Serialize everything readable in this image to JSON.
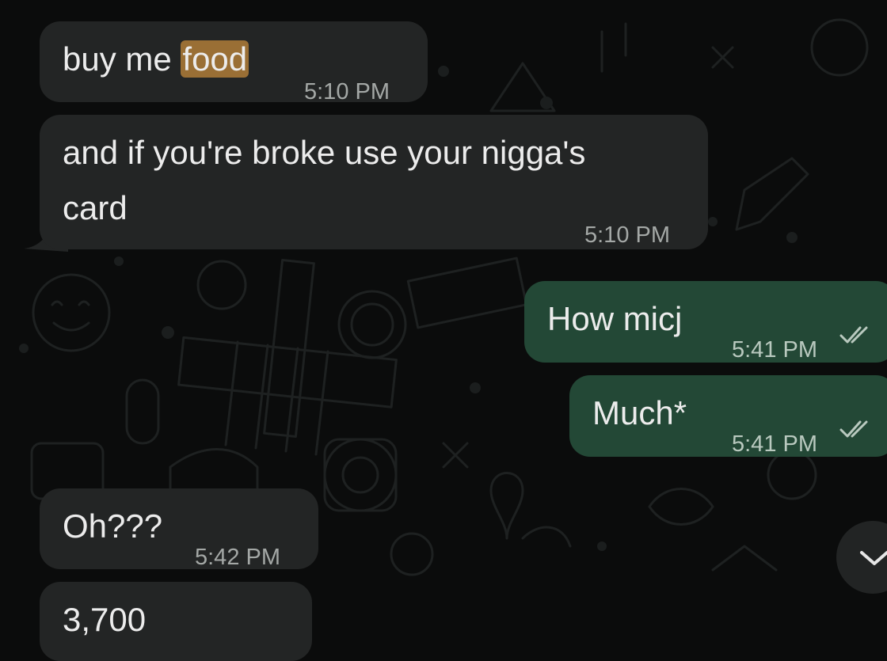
{
  "messages": [
    {
      "prefix": "buy me ",
      "highlight": "food",
      "time": "5:10 PM"
    },
    {
      "line1": "and if you're broke use your nigga's",
      "line2": "card",
      "time": "5:10 PM"
    },
    {
      "text": "How micj",
      "time": "5:41 PM"
    },
    {
      "text": "Much*",
      "time": "5:41 PM"
    },
    {
      "text": "Oh???",
      "time": "5:42 PM"
    },
    {
      "text": "3,700",
      "time": ""
    }
  ],
  "icons": {
    "read_receipt": "double-check-icon",
    "scroll_down": "chevron-down-icon"
  },
  "colors": {
    "background": "#0b0c0c",
    "incoming_bubble": "#232525",
    "outgoing_bubble": "#234836",
    "search_highlight": "#9a6f35"
  }
}
